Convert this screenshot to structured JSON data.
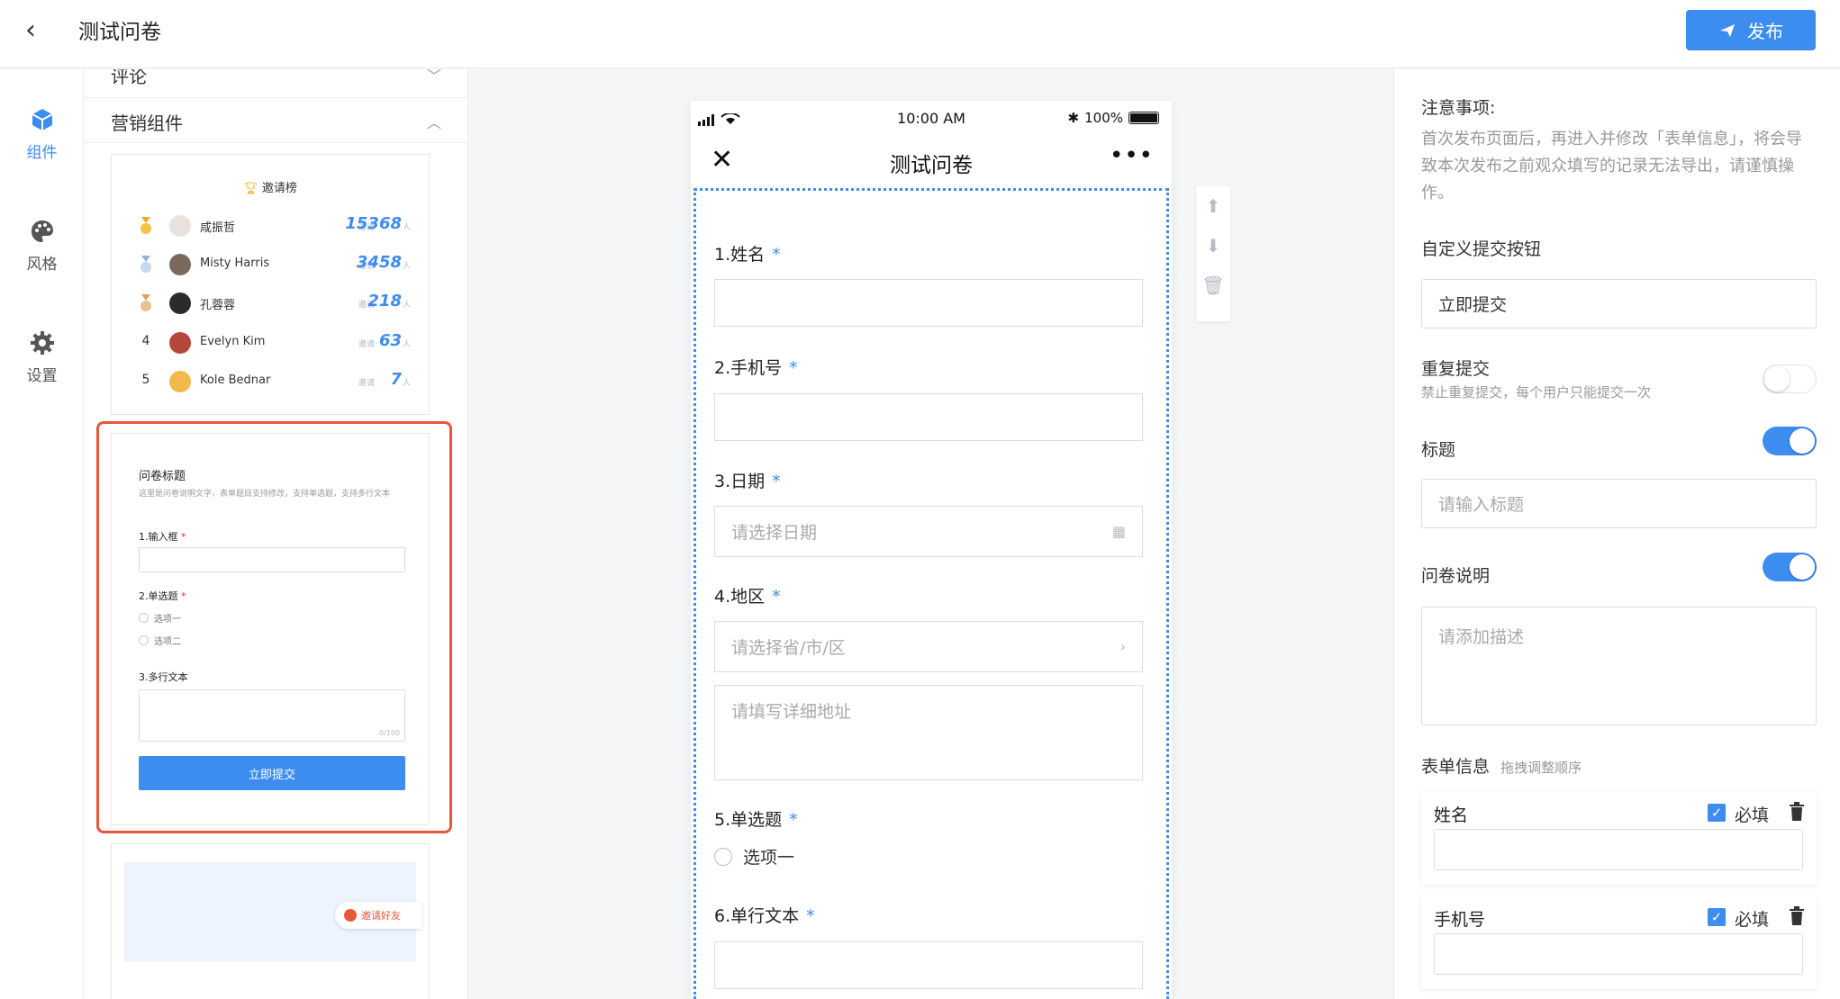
{
  "header": {
    "title": "测试问卷",
    "publish_label": "发布"
  },
  "nav": {
    "items": [
      {
        "label": "组件",
        "icon": "cube-icon",
        "active": true
      },
      {
        "label": "风格",
        "icon": "palette-icon"
      },
      {
        "label": "设置",
        "icon": "gear-icon"
      }
    ]
  },
  "components": {
    "sections": [
      {
        "label": "评论",
        "expanded": false
      },
      {
        "label": "营销组件",
        "expanded": true
      }
    ],
    "leaderboard": {
      "title": "邀请榜",
      "invite_label": "邀请",
      "unit": "人",
      "rows": [
        {
          "rank": "1",
          "name": "咸振哲",
          "score": "15368",
          "medal": "gold"
        },
        {
          "rank": "2",
          "name": "Misty Harris",
          "score": "3458",
          "medal": "silver"
        },
        {
          "rank": "3",
          "name": "孔蓉蓉",
          "score": "218",
          "medal": "bronze"
        },
        {
          "rank": "4",
          "name": "Evelyn Kim",
          "score": "63"
        },
        {
          "rank": "5",
          "name": "Kole Bednar",
          "score": "7"
        }
      ]
    },
    "mini_form": {
      "title": "问卷标题",
      "desc": "这里是问卷说明文字，表单题目支持修改，支持单选题，支持多行文本",
      "q1": "1.输入框",
      "q2": "2.单选题",
      "opt1": "选项一",
      "opt2": "选项二",
      "q3": "3.多行文本",
      "counter": "0/100",
      "submit": "立即提交"
    },
    "invite_friend_label": "邀请好友"
  },
  "phone": {
    "status_time": "10:00 AM",
    "battery": "100%",
    "title": "测试问卷",
    "questions": {
      "q1": "1.姓名",
      "q2": "2.手机号",
      "q3": "3.日期",
      "q3_placeholder": "请选择日期",
      "q4": "4.地区",
      "q4_placeholder": "请选择省/市/区",
      "q4_address_placeholder": "请填写详细地址",
      "q5": "5.单选题",
      "q5_option": "选项一",
      "q6": "6.单行文本"
    },
    "required_mark": "*"
  },
  "settings": {
    "note_title": "注意事项:",
    "note_text": "首次发布页面后，再进入并修改「表单信息」，将会导致本次发布之前观众填写的记录无法导出，请谨慎操作。",
    "submit_button_label": "自定义提交按钮",
    "submit_button_value": "立即提交",
    "repeat_label": "重复提交",
    "repeat_desc": "禁止重复提交，每个用户只能提交一次",
    "repeat_on": false,
    "title_label": "标题",
    "title_on": true,
    "title_placeholder": "请输入标题",
    "desc_label": "问卷说明",
    "desc_on": true,
    "desc_placeholder": "请添加描述",
    "form_info_label": "表单信息",
    "form_info_hint": "拖拽调整顺序",
    "required_label": "必填",
    "fields": [
      {
        "name": "姓名",
        "required": true
      },
      {
        "name": "手机号",
        "required": true
      }
    ]
  },
  "colors": {
    "accent": "#3d8cf0",
    "highlight": "#e8573a"
  }
}
